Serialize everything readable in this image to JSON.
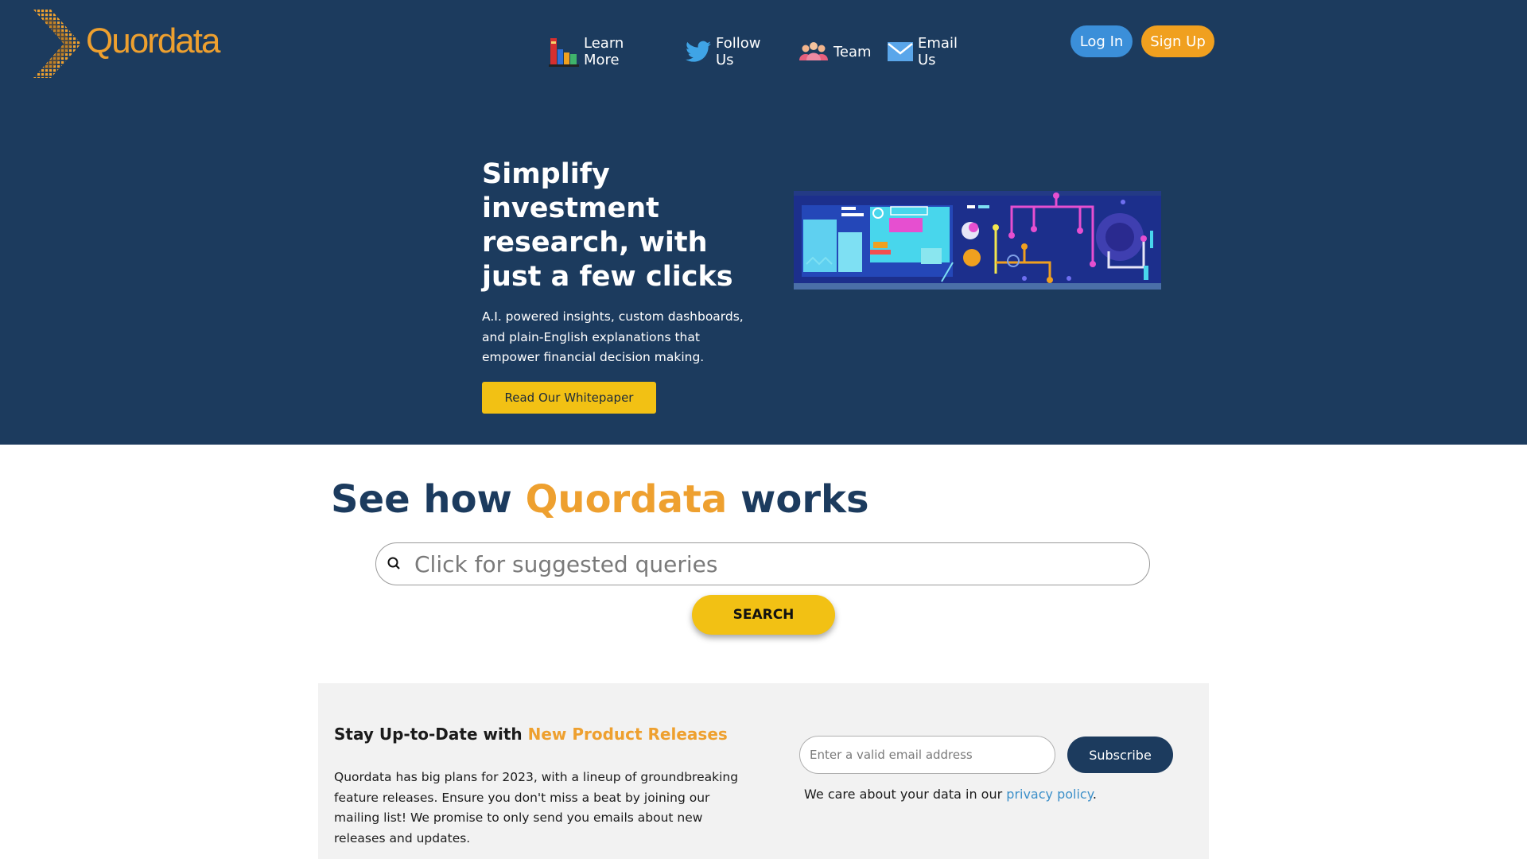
{
  "header": {
    "logo_text": "Quordata",
    "nav": [
      {
        "label": "Learn More",
        "icon": "books-icon"
      },
      {
        "label": "Follow Us",
        "icon": "twitter-bird-icon"
      },
      {
        "label": "Team",
        "icon": "team-people-icon"
      },
      {
        "label": "Email Us",
        "icon": "envelope-icon"
      }
    ],
    "login_label": "Log In",
    "signup_label": "Sign Up"
  },
  "hero": {
    "title": "Simplify investment research, with just a few clicks",
    "subtitle": "A.I. powered insights, custom dashboards, and plain-English explanations that empower financial decision making.",
    "cta_label": "Read Our Whitepaper",
    "illustration": "data-circuit-illustration"
  },
  "works": {
    "title_prefix": "See how ",
    "title_brand": "Quordata",
    "title_suffix": " works",
    "search_placeholder": "Click for suggested queries",
    "search_button": "SEARCH"
  },
  "newsletter": {
    "title_prefix": "Stay Up-to-Date with ",
    "title_accent": "New Product Releases",
    "body": "Quordata has big plans for 2023, with a lineup of groundbreaking feature releases. Ensure you don't miss a beat by joining our mailing list! We promise to only send you emails about new releases and updates.",
    "email_placeholder": "Enter a valid email address",
    "subscribe_label": "Subscribe",
    "privacy_prefix": "We care about your data in our ",
    "privacy_link": "privacy policy",
    "privacy_suffix": "."
  },
  "colors": {
    "navy": "#1c3b5e",
    "orange": "#eea02f",
    "yellow": "#f2c114",
    "blue": "#3b8fd9"
  }
}
